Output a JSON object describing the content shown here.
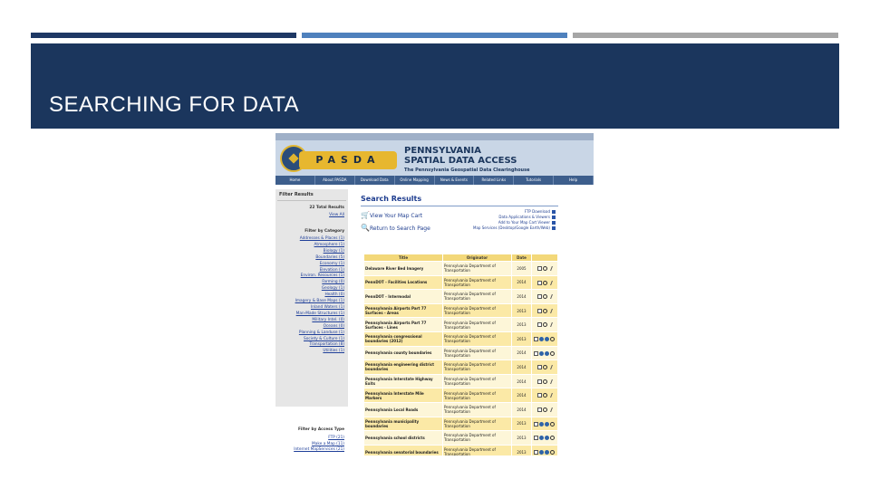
{
  "slide": {
    "title": "SEARCHING FOR DATA",
    "bar_colors": [
      "#1e3864",
      "#4f81bd",
      "#a6a6a6"
    ],
    "band_color": "#1b365d"
  },
  "site": {
    "logo_text": "PASDA",
    "title_line1": "PENNSYLVANIA",
    "title_line2": "SPATIAL DATA ACCESS",
    "tagline": "The Pennsylvania Geospatial Data Clearinghouse",
    "nav": [
      "Home",
      "About PASDA",
      "Download Data",
      "Online Mapping",
      "News & Events",
      "Related Links",
      "Tutorials",
      "Help"
    ]
  },
  "sidebar": {
    "heading": "Filter Results",
    "total": "22 Total Results",
    "view_all": "View All",
    "category_heading": "Filter by Category",
    "categories": [
      "Addresses & Places (1)",
      "Atmosphere (1)",
      "Biology (1)",
      "Boundaries (5)",
      "Economy (1)",
      "Elevation (1)",
      "Environ. Resources (1)",
      "Farming (0)",
      "Geology (1)",
      "Health (0)",
      "Imagery & Base Maps (1)",
      "Inland Waters (1)",
      "Man-Made Structures (1)",
      "Military Intel. (0)",
      "Oceans (0)",
      "Planning & Landuse (1)",
      "Society & Culture (1)",
      "Transportation (8)",
      "Utilities (1)"
    ],
    "access_heading": "Filter by Access Type",
    "access_types": [
      "FTP (21)",
      "Make a Map (11)",
      "Internet MapServices (21)"
    ]
  },
  "main": {
    "heading": "Search Results",
    "view_cart": "View Your Map Cart",
    "return_search": "Return to Search Page",
    "services": [
      "FTP Download",
      "Data Applications & Viewers",
      "Add to Your Map Cart Viewer",
      "Map Services (Desktop/Google Earth/Web)"
    ],
    "columns": [
      "Title",
      "Originator",
      "Date"
    ],
    "rows": [
      {
        "title": "Delaware River Bed Imagery",
        "originator": "Pennsylvania Department of Transportation",
        "date": "2005",
        "icons": [
          "download",
          "view",
          "link"
        ]
      },
      {
        "title": "PennDOT - Facilities Locations",
        "originator": "Pennsylvania Department of Transportation",
        "date": "2014",
        "icons": [
          "download",
          "view",
          "link"
        ]
      },
      {
        "title": "PennDOT - Intermodal",
        "originator": "Pennsylvania Department of Transportation",
        "date": "2014",
        "icons": [
          "download",
          "view",
          "link"
        ]
      },
      {
        "title": "Pennsylvania Airports Part 77 Surfaces - Areas",
        "originator": "Pennsylvania Department of Transportation",
        "date": "2013",
        "icons": [
          "download",
          "view",
          "link"
        ]
      },
      {
        "title": "Pennsylvania Airports Part 77 Surfaces - Lines",
        "originator": "Pennsylvania Department of Transportation",
        "date": "2013",
        "icons": [
          "download",
          "view",
          "link"
        ]
      },
      {
        "title": "Pennsylvania congressional boundaries (2012)",
        "originator": "Pennsylvania Department of Transportation",
        "date": "2013",
        "icons": [
          "download",
          "globe",
          "globe",
          "view",
          "link"
        ]
      },
      {
        "title": "Pennsylvania county boundaries",
        "originator": "Pennsylvania Department of Transportation",
        "date": "2014",
        "icons": [
          "download",
          "globe",
          "globe",
          "view",
          "link"
        ]
      },
      {
        "title": "Pennsylvania engineering district boundaries",
        "originator": "Pennsylvania Department of Transportation",
        "date": "2014",
        "icons": [
          "download",
          "view",
          "link"
        ]
      },
      {
        "title": "Pennsylvania Interstate Highway Exits",
        "originator": "Pennsylvania Department of Transportation",
        "date": "2014",
        "icons": [
          "download",
          "view",
          "link"
        ]
      },
      {
        "title": "Pennsylvania Interstate Mile Markers",
        "originator": "Pennsylvania Department of Transportation",
        "date": "2014",
        "icons": [
          "download",
          "view",
          "link"
        ]
      },
      {
        "title": "Pennsylvania Local Roads",
        "originator": "Pennsylvania Department of Transportation",
        "date": "2014",
        "icons": [
          "download",
          "view",
          "link"
        ]
      },
      {
        "title": "Pennsylvania municipality boundaries",
        "originator": "Pennsylvania Department of Transportation",
        "date": "2013",
        "icons": [
          "download",
          "globe",
          "globe",
          "view",
          "link"
        ]
      },
      {
        "title": "Pennsylvania school districts",
        "originator": "Pennsylvania Department of Transportation",
        "date": "2013",
        "icons": [
          "download",
          "globe",
          "globe",
          "view",
          "link"
        ]
      },
      {
        "title": "Pennsylvania senatorial boundaries",
        "originator": "Pennsylvania Department of Transportation",
        "date": "2013",
        "icons": [
          "download",
          "globe",
          "globe",
          "view",
          "link"
        ]
      }
    ]
  }
}
